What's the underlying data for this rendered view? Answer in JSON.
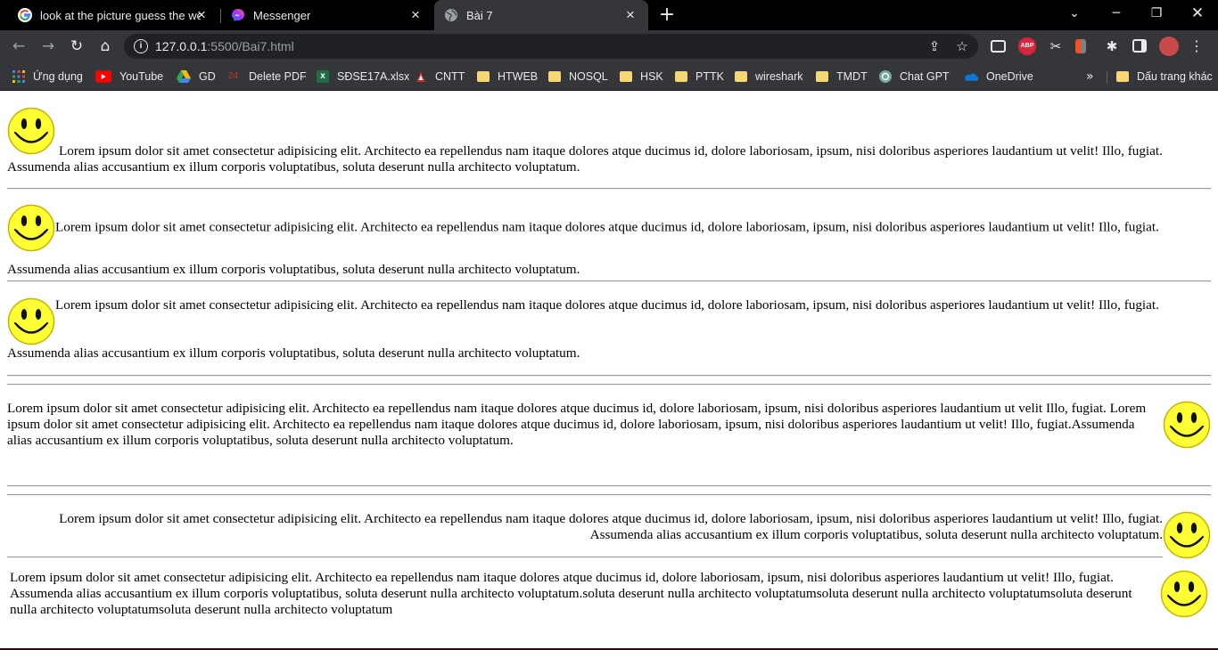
{
  "browser": {
    "tabs": [
      {
        "title": "look at the picture guess the wor",
        "active": false
      },
      {
        "title": "Messenger",
        "active": false
      },
      {
        "title": "Bài 7",
        "active": true
      }
    ],
    "new_tab": "+",
    "url_host": "127.0.0.1",
    "url_path": ":5500/Bai7.html",
    "bookmarks": [
      {
        "label": "Ứng dụng",
        "icon": "apps-grid-icon"
      },
      {
        "label": "YouTube",
        "icon": "youtube-icon"
      },
      {
        "label": "GD",
        "icon": "google-drive-icon"
      },
      {
        "label": "Delete PDF",
        "icon": "pdf-icon"
      },
      {
        "label": "SĐSE17A.xlsx",
        "icon": "excel-icon"
      },
      {
        "label": "CNTT",
        "icon": "cntt-icon"
      },
      {
        "label": "HTWEB",
        "icon": "folder-icon"
      },
      {
        "label": "NOSQL",
        "icon": "folder-icon"
      },
      {
        "label": "HSK",
        "icon": "folder-icon"
      },
      {
        "label": "PTTK",
        "icon": "folder-icon"
      },
      {
        "label": "wireshark",
        "icon": "folder-icon"
      },
      {
        "label": "TMDT",
        "icon": "folder-icon"
      },
      {
        "label": "Chat GPT",
        "icon": "chatgpt-icon"
      },
      {
        "label": "OneDrive",
        "icon": "onedrive-icon"
      }
    ],
    "bookmarks_overflow": "»",
    "other_bookmarks": "Dấu trang khác",
    "extension_badge": "ABP"
  },
  "content": {
    "p1": "Lorem ipsum dolor sit amet consectetur adipisicing elit. Architecto ea repellendus nam itaque dolores atque ducimus id, dolore laboriosam, ipsum, nisi doloribus asperiores laudantium ut velit! Illo, fugiat. Assumenda alias accusantium ex illum corporis voluptatibus, soluta deserunt nulla architecto voluptatum.",
    "p2": "Lorem ipsum dolor sit amet consectetur adipisicing elit. Architecto ea repellendus nam itaque dolores atque ducimus id, dolore laboriosam, ipsum, nisi doloribus asperiores laudantium ut velit! Illo, fugiat. Assumenda alias accusantium ex illum corporis voluptatibus, soluta deserunt nulla architecto voluptatum.",
    "p3": "Lorem ipsum dolor sit amet consectetur adipisicing elit. Architecto ea repellendus nam itaque dolores atque ducimus id, dolore laboriosam, ipsum, nisi doloribus asperiores laudantium ut velit! Illo, fugiat. Assumenda alias accusantium ex illum corporis voluptatibus, soluta deserunt nulla architecto voluptatum.",
    "p4": "Lorem ipsum dolor sit amet consectetur adipisicing elit. Architecto ea repellendus nam itaque dolores atque ducimus id, dolore laboriosam, ipsum, nisi doloribus asperiores laudantium ut velit Illo, fugiat. Lorem ipsum dolor sit amet consectetur adipisicing elit. Architecto ea repellendus nam itaque dolores atque ducimus id, dolore laboriosam, ipsum, nisi doloribus asperiores laudantium ut velit! Illo, fugiat.Assumenda alias accusantium ex illum corporis voluptatibus, soluta deserunt nulla architecto voluptatum.",
    "p5": "Lorem ipsum dolor sit amet consectetur adipisicing elit. Architecto ea repellendus nam itaque dolores atque ducimus id, dolore laboriosam, ipsum, nisi doloribus asperiores laudantium ut velit! Illo, fugiat. Assumenda alias accusantium ex illum corporis voluptatibus, soluta deserunt nulla architecto voluptatum.",
    "p6": "Lorem ipsum dolor sit amet consectetur adipisicing elit. Architecto ea repellendus nam itaque dolores atque ducimus id, dolore laboriosam, ipsum, nisi doloribus asperiores laudantium ut velit! Illo, fugiat. Assumenda alias accusantium ex illum corporis voluptatibus, soluta deserunt nulla architecto voluptatum.soluta deserunt nulla architecto voluptatumsoluta deserunt nulla architecto voluptatumsoluta deserunt nulla architecto voluptatumsoluta deserunt nulla architecto voluptatum"
  },
  "colors": {
    "tab_bar": "#000000",
    "toolbar": "#35363a",
    "omnibox": "#202124",
    "smiley_face": "#ffff33",
    "smiley_outline": "#c9b200"
  }
}
